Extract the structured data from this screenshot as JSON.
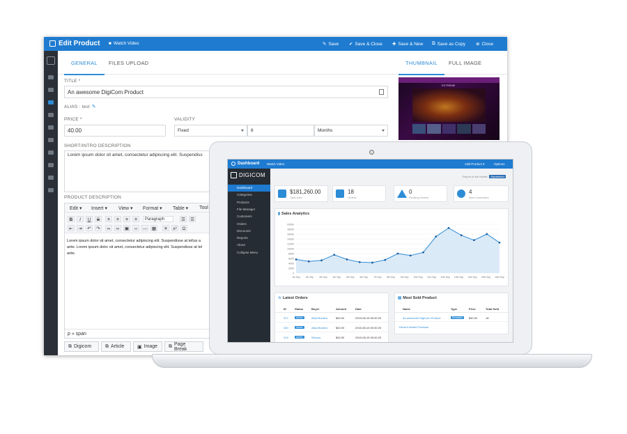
{
  "window": {
    "title": "Edit Product",
    "watch_video": "Watch Video",
    "actions": {
      "save": "Save",
      "save_close": "Save & Close",
      "save_new": "Save & New",
      "save_copy": "Save as Copy",
      "close": "Close"
    }
  },
  "tabs": {
    "general": "GENERAL",
    "files_upload": "FILES UPLOAD",
    "thumbnail": "THUMBNAIL",
    "full_image": "FULL IMAGE"
  },
  "form": {
    "title_label": "TITLE *",
    "title_value": "An awesome DigiCom Product",
    "alias_label": "ALIAS : test",
    "price_label": "PRICE *",
    "price_value": "40.00",
    "validity_label": "VALIDITY",
    "validity_type": "Fixed",
    "validity_number": "6",
    "validity_unit": "Months",
    "short_desc_label": "SHORT/INTRO DESCRIPTION",
    "short_desc_value": "Lorem ipsum dolor sit amet, consectetur adipiscing elit. Suspendiss",
    "product_desc_label": "PRODUCT DESCRIPTION"
  },
  "editor": {
    "menus": [
      "Edit ▾",
      "Insert ▾",
      "View ▾",
      "Format ▾",
      "Table ▾",
      "Tool"
    ],
    "paragraph": "Paragraph",
    "content_lines": [
      "Lorem ipsum dolor sit amet, consectetur adipiscing elit. Suspendisse at tellus a",
      "ante. Lorem ipsum dolor sit amet, consectetur adipiscing elit. Suspendisse at tel",
      "ante."
    ],
    "path": "p » span"
  },
  "bottom_buttons": [
    "Digicom",
    "Article",
    "Image",
    "Page Break"
  ],
  "thumb": {
    "site_name": "EXTREME"
  },
  "dashboard": {
    "bar_title": "Dashboard",
    "bar_watch": "Watch Video",
    "add_product": "Add Product ▾",
    "options": "Options",
    "logo": "DIGICOM",
    "report_text": "Report of the Month:",
    "report_month": "September",
    "nav": [
      "Dashboard",
      "Categories",
      "Products",
      "File Manager",
      "Customers",
      "Orders",
      "Discounts",
      "Reports",
      "About",
      "Collapse Menu"
    ],
    "stats": [
      {
        "value": "$181,260.00",
        "label": "Total Sale"
      },
      {
        "value": "18",
        "label": "Orders"
      },
      {
        "value": "0",
        "label": "Pending Orders"
      },
      {
        "value": "4",
        "label": "New Customers"
      }
    ],
    "sales_title": "Sales Analytics",
    "latest_title": "Latest Orders",
    "latest_headers": [
      "ID",
      "Status",
      "Buyer",
      "Amount",
      "Date"
    ],
    "latest_rows": [
      [
        "317",
        "Active",
        "Alba Mundra",
        "$40.00",
        "2015-08-15 00:00:20"
      ],
      [
        "320",
        "Active",
        "Alba Mundra",
        "$40.00",
        "2015-08-15 00:00:20"
      ],
      [
        "319",
        "Active",
        "Silvana",
        "$40.00",
        "2015-08-15 00:00:20"
      ]
    ],
    "most_sold_title": "Most Sold Product",
    "most_sold_headers": [
      "Name",
      "Type",
      "Price",
      "Total Sold"
    ],
    "most_sold_row": [
      "An awesome DigiCom Product",
      "Reusable",
      "$40.00",
      "18"
    ],
    "recent_link": "Recent Added Products"
  },
  "chart_data": {
    "type": "area",
    "title": "Sales Analytics",
    "x": [
      "1th Sep",
      "2th Sep",
      "3th Sep",
      "4th Sep",
      "5th Sep",
      "6th Sep",
      "7th Sep",
      "8th Sep",
      "9th Sep",
      "10th Sep",
      "11th Sep",
      "12th Sep",
      "13th Sep",
      "14th Sep",
      "15th Sep",
      "16th Sep"
    ],
    "series": [
      {
        "values": [
          5600,
          4800,
          5200,
          7500,
          5600,
          4500,
          4300,
          5400,
          8000,
          7200,
          8500,
          15000,
          18500,
          15500,
          13500,
          16000,
          12500
        ]
      }
    ],
    "yticks": [
      20000,
      18000,
      16000,
      14000,
      12000,
      10000,
      8000,
      6000,
      4000,
      2000,
      0
    ],
    "ylim": [
      0,
      20000
    ],
    "color": "#2d8cd6",
    "fill": "#dbeaf7"
  }
}
